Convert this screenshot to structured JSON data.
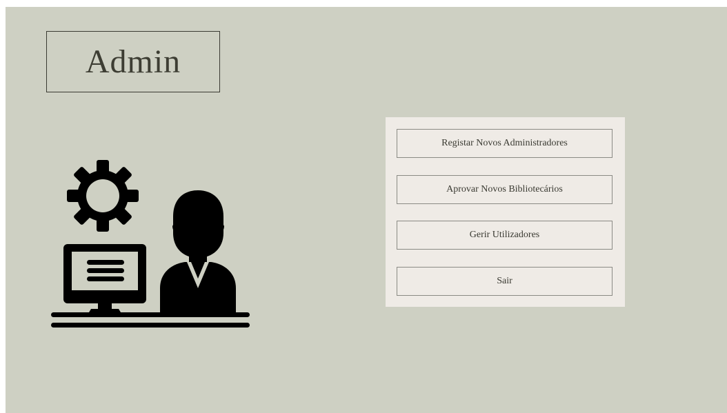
{
  "header": {
    "title": "Admin"
  },
  "illustration": {
    "icon": "admin-computer-settings-icon",
    "color": "#000000"
  },
  "menu": {
    "items": [
      {
        "label": "Registar Novos Administradores"
      },
      {
        "label": "Aprovar Novos Bibliotecários"
      },
      {
        "label": "Gerir Utilizadores"
      },
      {
        "label": "Sair"
      }
    ]
  },
  "colors": {
    "background": "#ced0c3",
    "panel": "#efebe6",
    "text": "#3d3d33"
  }
}
